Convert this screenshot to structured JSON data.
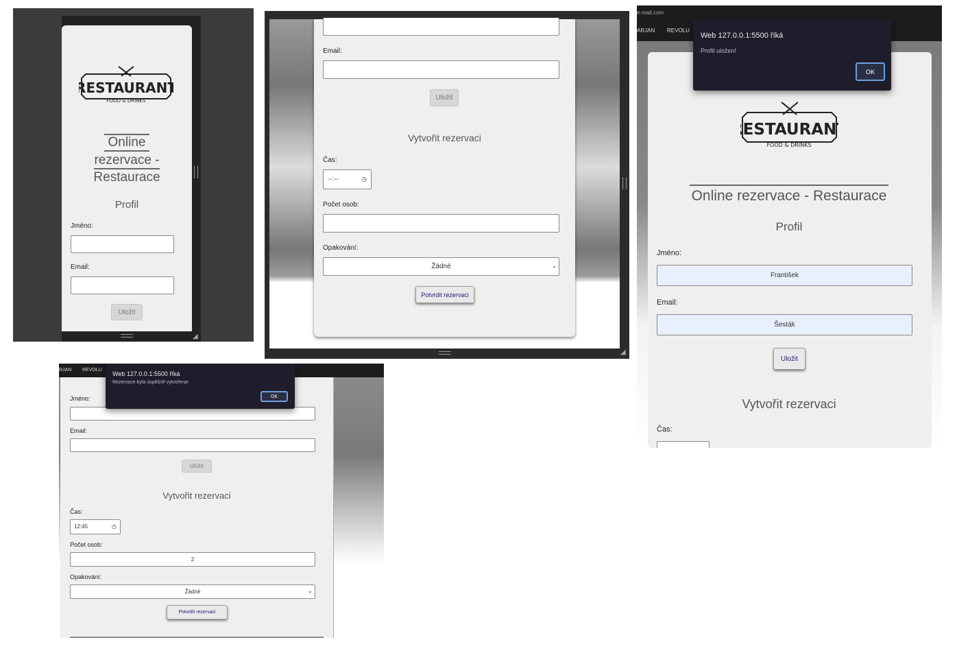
{
  "logo": {
    "main": "RESTAURANT",
    "sub": "FOOD & DRINKS"
  },
  "page": {
    "title_lines": [
      "Online",
      "rezervace -",
      "Restaurace"
    ],
    "title": "Online rezervace - Restaurace"
  },
  "profile": {
    "heading": "Profil",
    "name_label": "Jméno:",
    "email_label": "Email:",
    "save_label": "Uložit",
    "name_value": "František",
    "email_value": "Šesták"
  },
  "reservation": {
    "heading": "Vytvořit rezervaci",
    "time_label": "Čas:",
    "time_placeholder": "--:--",
    "time_value": "12:45",
    "persons_label": "Počet osob:",
    "persons_value": "2",
    "repeat_label": "Opakování:",
    "repeat_value": "Žádné",
    "submit_label": "Potvrdit rezervaci"
  },
  "dialogs": {
    "saved": {
      "title": "Web 127.0.0.1:5500 říká",
      "message": "Profil uložen!",
      "ok": "OK"
    },
    "reserved": {
      "title": "Web 127.0.0.1:5500 říká",
      "message": "Rezervace byla úspěšně vytvořena!",
      "ok": "OK"
    }
  },
  "browser": {
    "url_fragment": "e-mail.com",
    "bookmark_1": "ARJAN",
    "bookmark_2": "REVOLU",
    "tab_fragment": "RJAN",
    "tab_fragment_2": "REVOLU"
  },
  "colors": {
    "dark_bg": "#3a3a3a",
    "card_bg": "#f1efed",
    "dialog_bg": "#1f1d2b",
    "autofill_bg": "#e8f0fe"
  }
}
